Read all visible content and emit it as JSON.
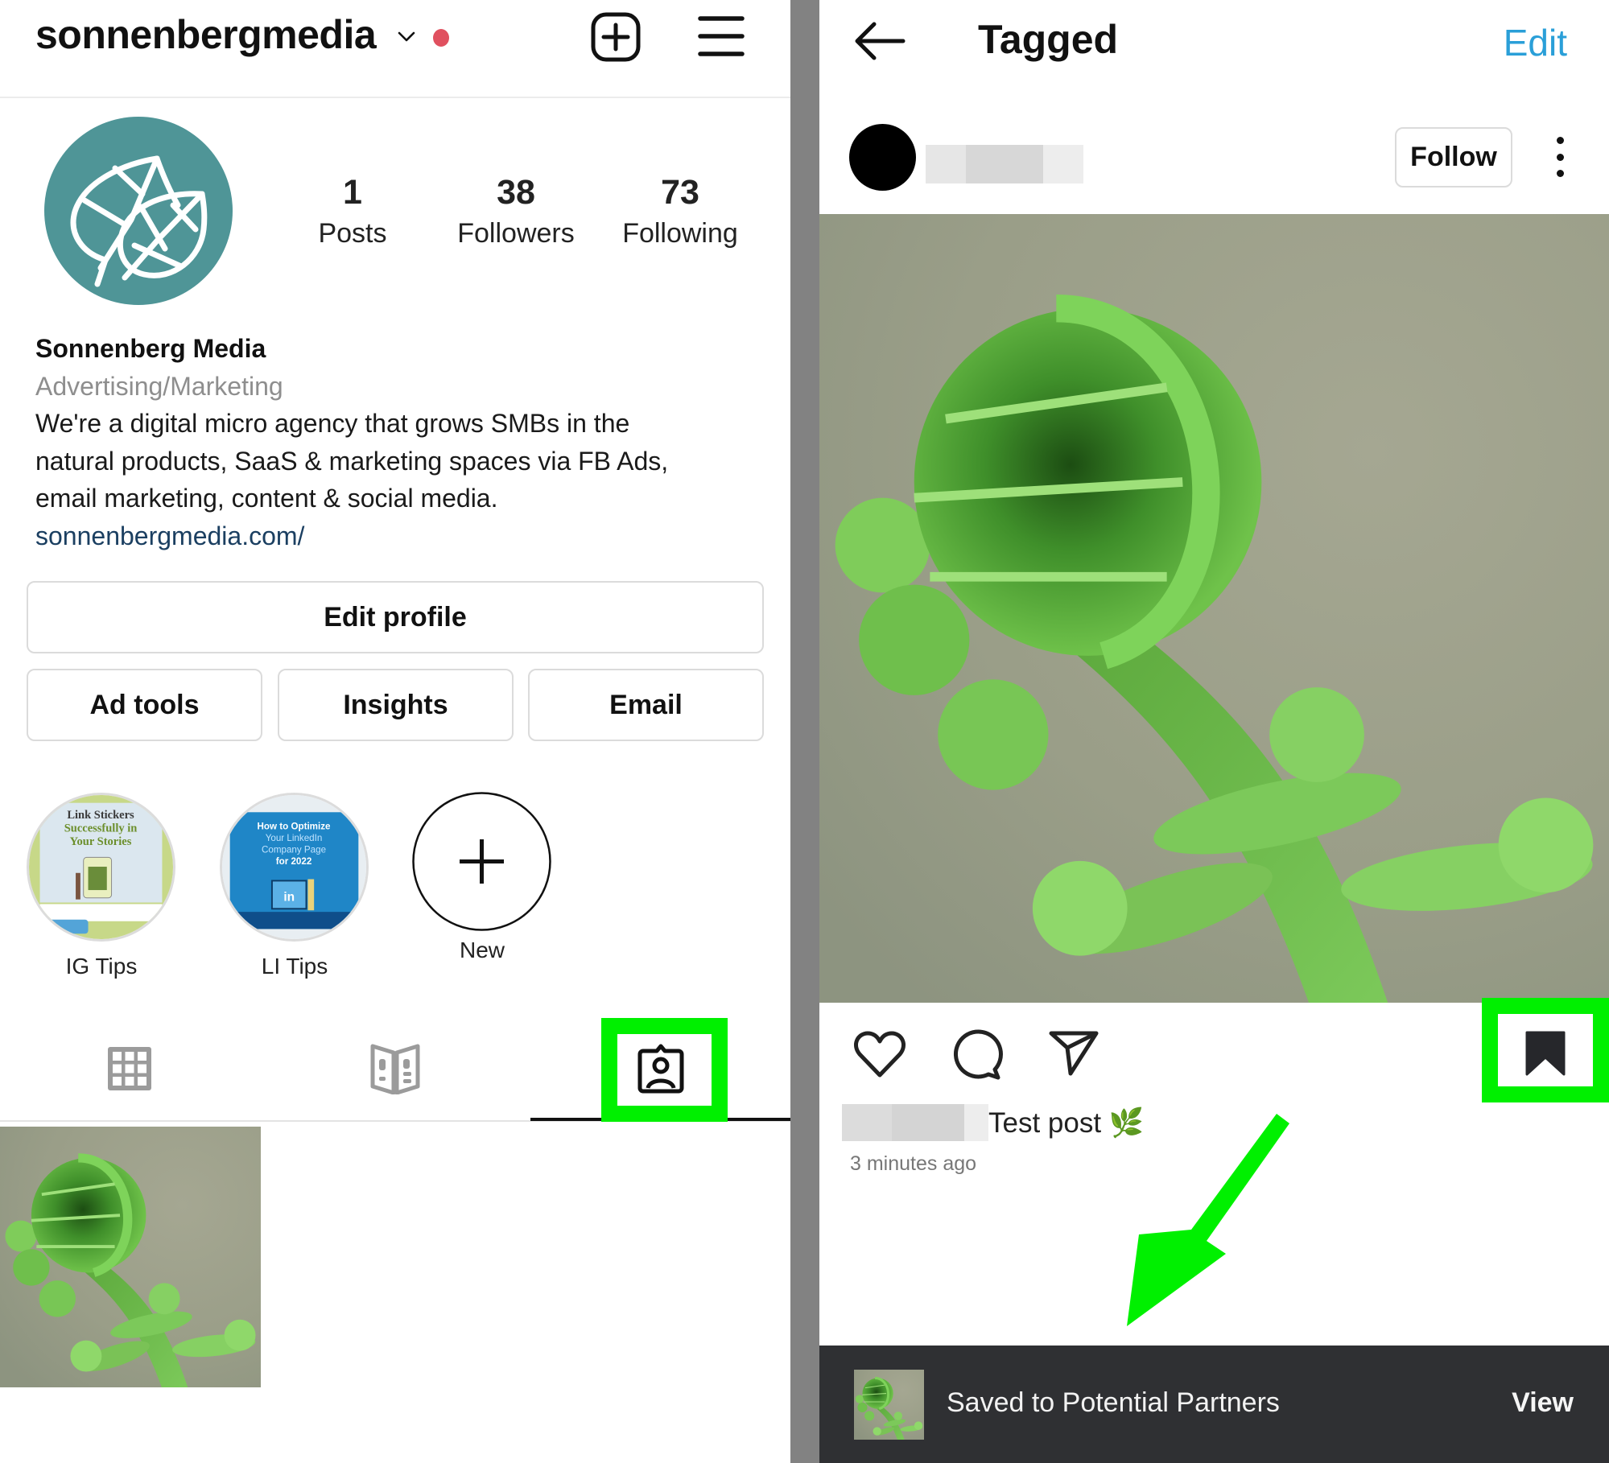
{
  "profile_screen": {
    "header": {
      "username": "sonnenbergmedia",
      "switch_account_icon": "chevron-down-icon",
      "notification_dot_color": "#e0505f",
      "create_icon": "plus-square-icon",
      "menu_icon": "hamburger-menu-icon"
    },
    "avatar": {
      "icon": "leaf-logo-icon",
      "bg_color": "#4f9597"
    },
    "stats": [
      {
        "value": "1",
        "label": "Posts"
      },
      {
        "value": "38",
        "label": "Followers"
      },
      {
        "value": "73",
        "label": "Following"
      }
    ],
    "bio": {
      "name": "Sonnenberg Media",
      "category": "Advertising/Marketing",
      "lines": [
        "We're a digital micro agency that grows SMBs in the",
        "natural products, SaaS & marketing spaces via FB Ads,",
        "email marketing, content & social media."
      ],
      "link": "sonnenbergmedia.com/"
    },
    "buttons": {
      "edit_profile": "Edit profile",
      "ad_tools": "Ad tools",
      "insights": "Insights",
      "email": "Email"
    },
    "highlights": [
      {
        "label": "IG Tips",
        "cover_title": "Link Stickers Successfully in Your Stories"
      },
      {
        "label": "LI Tips",
        "cover_title": "How to Optimize Your LinkedIn Company Page for 2022"
      },
      {
        "label": "New",
        "icon": "plus-icon"
      }
    ],
    "tabs": [
      {
        "name": "posts-grid",
        "icon": "grid-icon",
        "active": false
      },
      {
        "name": "guides",
        "icon": "guide-icon",
        "active": false
      },
      {
        "name": "tagged",
        "icon": "tagged-person-icon",
        "active": true
      }
    ],
    "highlight_color": "#00f000"
  },
  "tagged_screen": {
    "header": {
      "back_icon": "back-arrow-icon",
      "title": "Tagged",
      "edit_label": "Edit",
      "edit_color": "#2a9fd8"
    },
    "post": {
      "author_name_redacted": true,
      "follow_label": "Follow",
      "more_icon": "more-vertical-icon",
      "image_alt": "Green fern fiddlehead",
      "actions": [
        "heart-icon",
        "comment-icon",
        "share-icon"
      ],
      "save_icon": "bookmark-filled-icon",
      "caption": "Test post 🌿",
      "timestamp": "3 minutes ago"
    },
    "toast": {
      "message": "Saved to Potential Partners",
      "action_label": "View",
      "bg_color": "#2f3033"
    },
    "annotation": {
      "type": "arrow",
      "color": "#00f000",
      "points_to": "toast"
    }
  }
}
